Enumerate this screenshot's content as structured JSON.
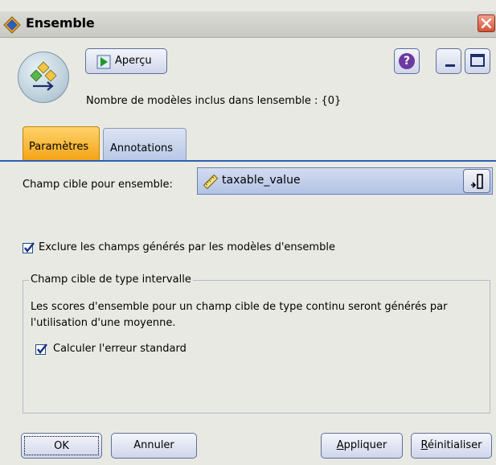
{
  "window": {
    "title": "Ensemble"
  },
  "toolbar": {
    "preview_label": "Aperçu",
    "help_symbol": "?"
  },
  "header": {
    "model_count_text": "Nombre de modèles inclus dans lensemble : {0}"
  },
  "tabs": [
    {
      "label": "Paramètres",
      "active": true
    },
    {
      "label": "Annotations",
      "active": false
    }
  ],
  "settings": {
    "target_field_label": "Champ cible pour ensemble:",
    "target_field_value": "taxable_value",
    "exclude_checkbox_label": "Exclure les champs générés par les modèles d'ensemble",
    "exclude_checked": true,
    "group_title": "Champ cible de type intervalle",
    "group_description": "Les scores d'ensemble pour un champ cible de type continu seront générés par l'utilisation d'une moyenne.",
    "std_error_label": "Calculer l'erreur standard",
    "std_error_checked": true
  },
  "buttons": {
    "ok": "OK",
    "cancel": "Annuler",
    "apply_prefix": "A",
    "apply_rest": "ppliquer",
    "reset_prefix": "R",
    "reset_rest": "éinitialiser"
  },
  "colors": {
    "active_tab": "#f3a417",
    "tab_underline": "#2b5fb4",
    "close_button": "#d35436",
    "field_select": "#b3c3e5"
  },
  "icons": [
    "ensemble-node-icon",
    "play-icon",
    "help-icon",
    "minimize-icon",
    "maximize-icon",
    "close-icon",
    "ruler-icon",
    "dropdown-icon",
    "checkmark-icon"
  ]
}
